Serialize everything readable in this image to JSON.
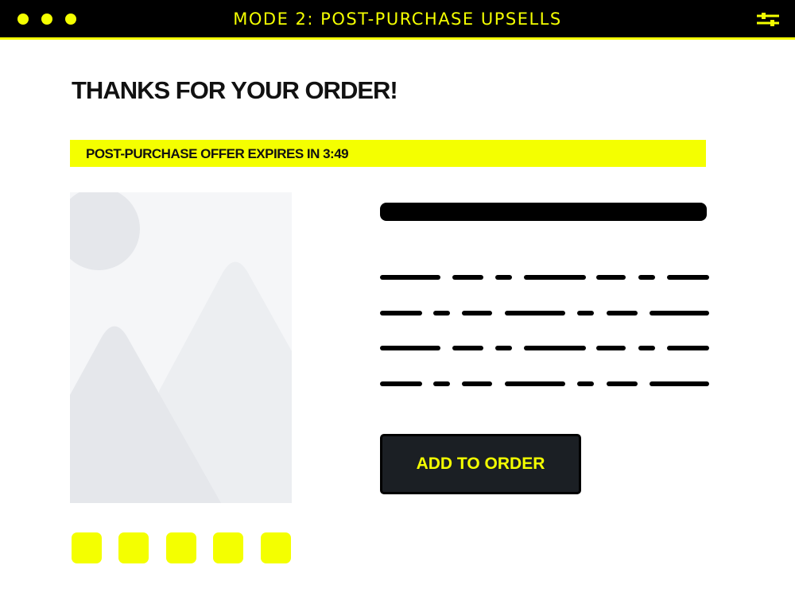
{
  "window": {
    "title": "MODE 2: POST-PURCHASE UPSELLS",
    "controls": [
      "dot",
      "dot",
      "dot"
    ],
    "settings_icon": "sliders-icon"
  },
  "page": {
    "heading": "THANKS FOR YOUR ORDER!",
    "offer_text": "POST-PURCHASE OFFER EXPIRES IN 3:49",
    "add_button_label": "ADD TO ORDER",
    "thumbnails": 5
  },
  "colors": {
    "accent": "#f4ff00",
    "titlebar": "#000000",
    "button_bg": "#1b1f24",
    "placeholder_bg": "#f5f6f8",
    "placeholder_shape": "#e5e7eb"
  }
}
